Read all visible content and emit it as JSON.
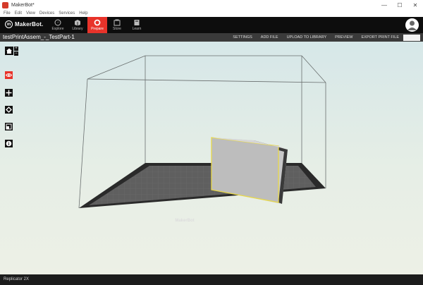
{
  "window": {
    "title": "MakerBot*",
    "minimize": "—",
    "maximize": "☐",
    "close": "✕"
  },
  "menu": [
    "File",
    "Edit",
    "View",
    "Devices",
    "Services",
    "Help"
  ],
  "navbar": {
    "logo_text": "MakerBot.",
    "tabs": [
      {
        "label": "Explore",
        "icon": "compass-icon"
      },
      {
        "label": "Library",
        "icon": "library-icon"
      },
      {
        "label": "Prepare",
        "icon": "prepare-icon"
      },
      {
        "label": "Store",
        "icon": "store-icon"
      },
      {
        "label": "Learn",
        "icon": "learn-icon"
      }
    ],
    "active_tab": "Prepare",
    "active_color": "#e8332a"
  },
  "toolbar": {
    "file_name": "testPrintAssem_-_TestPart-1",
    "actions": [
      "SETTINGS",
      "ADD FILE",
      "UPLOAD TO LIBRARY",
      "PREVIEW",
      "EXPORT PRINT FILE"
    ]
  },
  "viewport": {
    "build_plate_logo": "MakerBot",
    "zoom_in": "+",
    "zoom_out": "−",
    "tools": [
      "eye-icon",
      "move-icon",
      "rotate-icon",
      "scale-icon",
      "info-icon"
    ]
  },
  "status": {
    "printer": "Replicator 2X"
  }
}
